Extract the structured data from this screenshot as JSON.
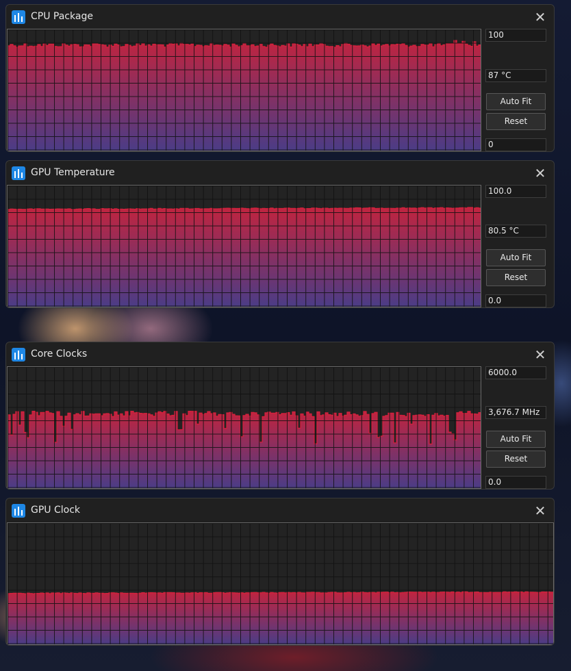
{
  "windows": [
    {
      "title": "CPU Package",
      "max_value": "100",
      "current_value": "87 °C",
      "min_value": "0",
      "auto_fit_label": "Auto Fit",
      "reset_label": "Reset",
      "graph": {
        "min": 0,
        "max": 100,
        "level": 87,
        "variation": "noise"
      }
    },
    {
      "title": "GPU Temperature",
      "max_value": "100.0",
      "current_value": "80.5 °C",
      "min_value": "0.0",
      "auto_fit_label": "Auto Fit",
      "reset_label": "Reset",
      "graph": {
        "min": 0,
        "max": 100,
        "level": 80.5,
        "variation": "flat"
      }
    },
    {
      "title": "Core Clocks",
      "max_value": "6000.0",
      "current_value": "3,676.7 MHz",
      "min_value": "0.0",
      "auto_fit_label": "Auto Fit",
      "reset_label": "Reset",
      "graph": {
        "min": 0,
        "max": 6000,
        "level": 3676.7,
        "variation": "spiky"
      }
    },
    {
      "title": "GPU Clock",
      "graph": {
        "level_fraction": 0.42,
        "variation": "flat"
      }
    }
  ],
  "colors": {
    "line": "#d8203c",
    "fill_top": "#c0243f",
    "fill_bottom": "#4b3c86",
    "graph_bg": "#232323",
    "grid": "#111111",
    "window_bg": "#202020",
    "icon_blue": "#1e87e5"
  },
  "icons": {
    "app": "hwinfo-graph-icon",
    "close": "close-icon"
  }
}
